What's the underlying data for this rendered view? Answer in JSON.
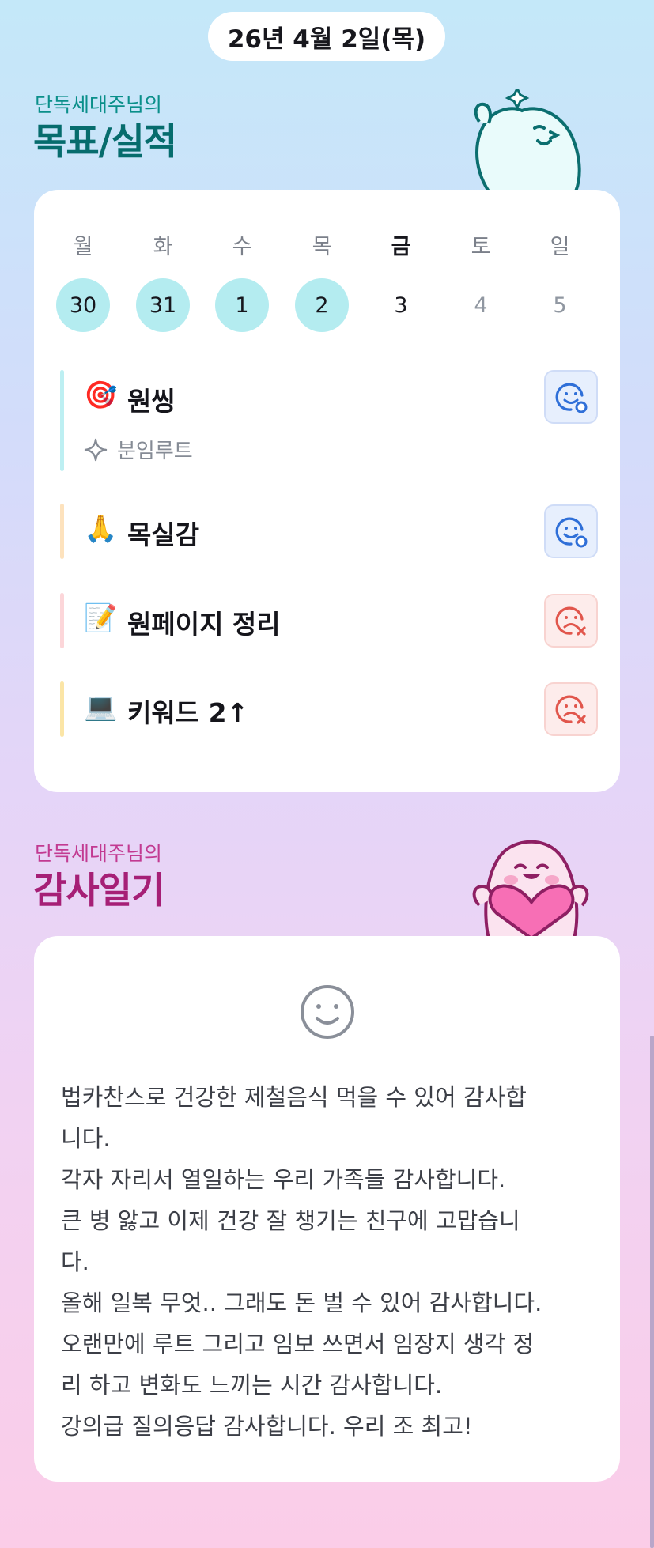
{
  "header": {
    "date": "26년 4월 2일(목)"
  },
  "goals_section": {
    "subtitle": "단독세대주님의",
    "title": "목표/실적"
  },
  "week": {
    "days": [
      {
        "name": "월",
        "num": "30",
        "state": "done"
      },
      {
        "name": "화",
        "num": "31",
        "state": "done"
      },
      {
        "name": "수",
        "num": "1",
        "state": "done"
      },
      {
        "name": "목",
        "num": "2",
        "state": "done"
      },
      {
        "name": "금",
        "num": "3",
        "state": "today"
      },
      {
        "name": "토",
        "num": "4",
        "state": "future"
      },
      {
        "name": "일",
        "num": "5",
        "state": "future"
      }
    ]
  },
  "goals": [
    {
      "emoji": "🎯",
      "text": "원씽",
      "sub": "분임루트",
      "status": "success",
      "bar_color": "#bdeff2"
    },
    {
      "emoji": "🙏",
      "text": "목실감",
      "status": "success",
      "bar_color": "#fde2bd"
    },
    {
      "emoji": "📝",
      "text": "원페이지 정리",
      "status": "fail",
      "bar_color": "#fcd6d9"
    },
    {
      "emoji": "💻",
      "text": "키워드 2↑",
      "status": "fail",
      "bar_color": "#fbe5a6"
    }
  ],
  "diary_section": {
    "subtitle": "단독세대주님의",
    "title": "감사일기"
  },
  "diary": {
    "mood_icon": "smile-icon",
    "text": "법카찬스로 건강한 제철음식 먹을 수 있어 감사합\n니다.\n각자 자리서 열일하는 우리 가족들 감사합니다.\n큰 병 앓고 이제 건강 잘 챙기는 친구에 고맙습니\n다.\n올해 일복 무엇.. 그래도 돈 벌 수 있어 감사합니다.\n오랜만에 루트 그리고 임보 쓰면서 임장지 생각 정\n리 하고 변화도 느끼는 시간 감사합니다.\n강의급 질의응답 감사합니다. 우리 조 최고!"
  },
  "colors": {
    "success": "#2f6fd8",
    "fail": "#e1564c",
    "teal": "#0a8f8a",
    "magenta": "#c23a91"
  }
}
